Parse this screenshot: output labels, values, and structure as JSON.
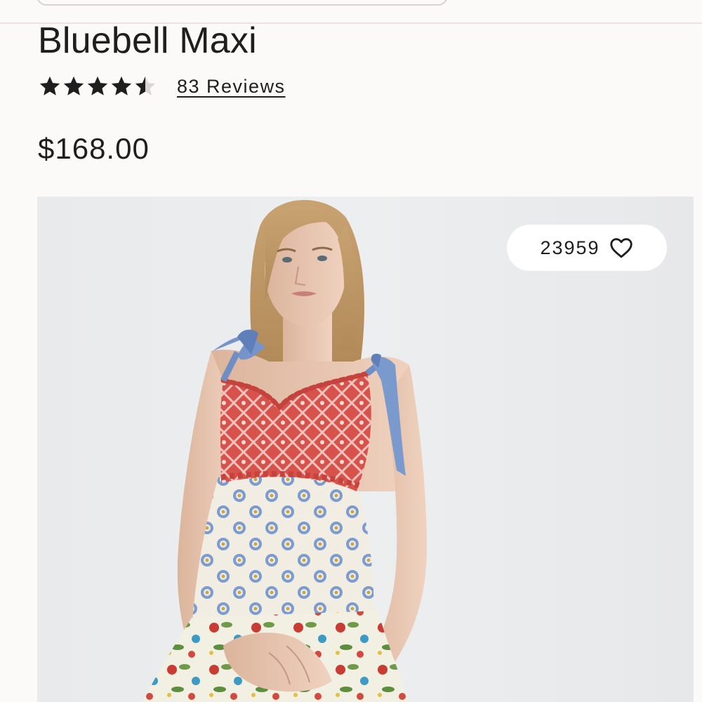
{
  "product": {
    "title": "Bluebell Maxi",
    "rating": 4.5,
    "rating_max": 5,
    "reviews_label": "83 Reviews",
    "price": "$168.00"
  },
  "image": {
    "likes": "23959",
    "alt": "Bluebell Maxi"
  },
  "colors": {
    "background": "#fbfaf9",
    "text": "#1e1e1e",
    "ribbon": "#6f8fc4",
    "smocked_bodice": "#d9534f"
  },
  "icons": [
    "star-icon",
    "heart-icon"
  ]
}
